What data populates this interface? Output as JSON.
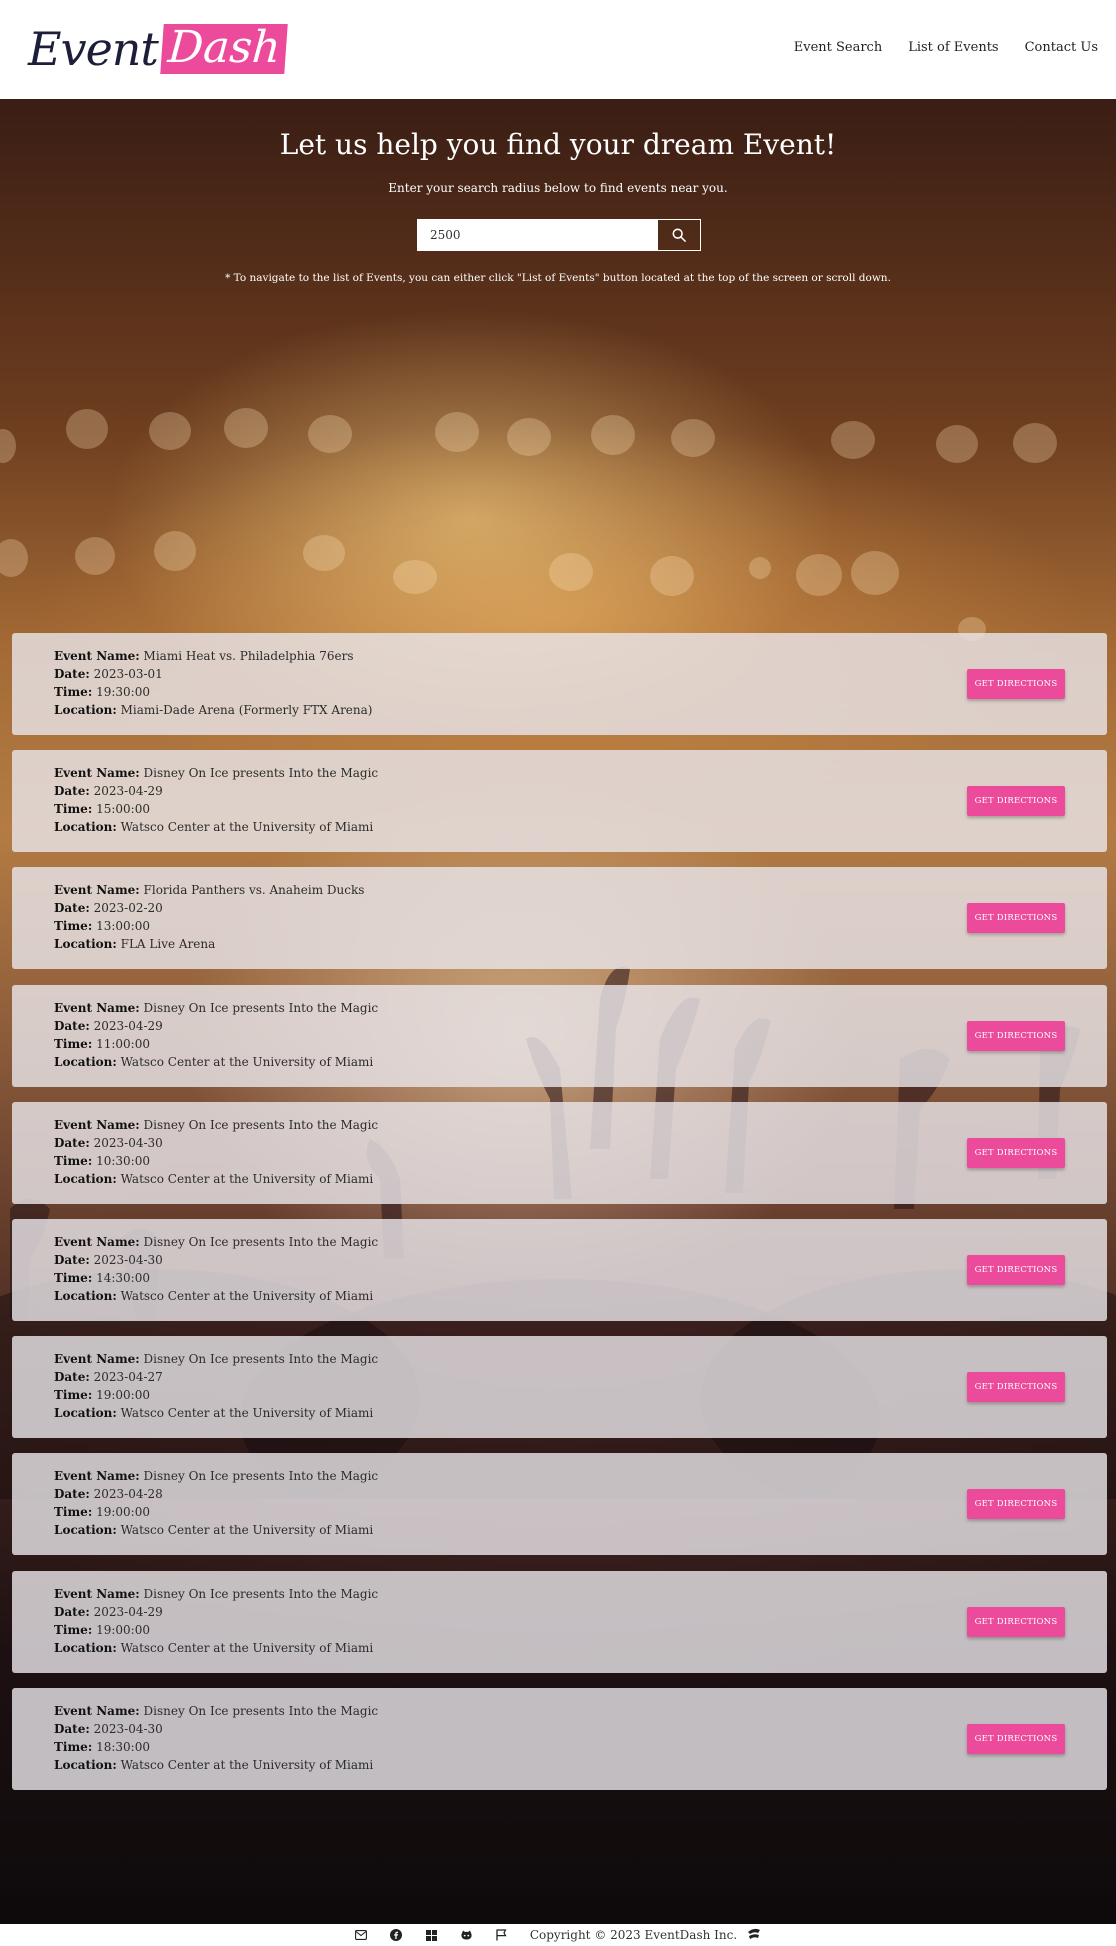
{
  "brand": {
    "logo_part1": "Event",
    "logo_part2": "Dash",
    "accent_color": "#ec4a9b"
  },
  "nav": {
    "items": [
      "Event Search",
      "List of Events",
      "Contact Us"
    ]
  },
  "hero": {
    "title": "Let us help you find your dream Event!",
    "subtitle": "Enter your search radius below to find events near you.",
    "search_value": "2500",
    "search_icon": "search-icon",
    "note": "* To navigate to the list of Events, you can either click \"List of Events\" button located at the top of the screen or scroll down."
  },
  "labels": {
    "name": "Event Name:",
    "date": "Date:",
    "time": "Time:",
    "location": "Location:",
    "button": "GET DIRECTIONS"
  },
  "events": [
    {
      "name": "Miami Heat vs. Philadelphia 76ers",
      "date": "2023-03-01",
      "time": "19:30:00",
      "location": "Miami-Dade Arena (Formerly FTX Arena)"
    },
    {
      "name": "Disney On Ice presents Into the Magic",
      "date": "2023-04-29",
      "time": "15:00:00",
      "location": "Watsco Center at the University of Miami"
    },
    {
      "name": "Florida Panthers vs. Anaheim Ducks",
      "date": "2023-02-20",
      "time": "13:00:00",
      "location": "FLA Live Arena"
    },
    {
      "name": "Disney On Ice presents Into the Magic",
      "date": "2023-04-29",
      "time": "11:00:00",
      "location": "Watsco Center at the University of Miami"
    },
    {
      "name": "Disney On Ice presents Into the Magic",
      "date": "2023-04-30",
      "time": "10:30:00",
      "location": "Watsco Center at the University of Miami"
    },
    {
      "name": "Disney On Ice presents Into the Magic",
      "date": "2023-04-30",
      "time": "14:30:00",
      "location": "Watsco Center at the University of Miami"
    },
    {
      "name": "Disney On Ice presents Into the Magic",
      "date": "2023-04-27",
      "time": "19:00:00",
      "location": "Watsco Center at the University of Miami"
    },
    {
      "name": "Disney On Ice presents Into the Magic",
      "date": "2023-04-28",
      "time": "19:00:00",
      "location": "Watsco Center at the University of Miami"
    },
    {
      "name": "Disney On Ice presents Into the Magic",
      "date": "2023-04-29",
      "time": "19:00:00",
      "location": "Watsco Center at the University of Miami"
    },
    {
      "name": "Disney On Ice presents Into the Magic",
      "date": "2023-04-30",
      "time": "18:30:00",
      "location": "Watsco Center at the University of Miami"
    }
  ],
  "footer": {
    "icons": [
      "mail-icon",
      "facebook-icon",
      "windows-icon",
      "github-icon",
      "flag-icon"
    ],
    "copyright": "Copyright © 2023 EventDash Inc.",
    "logo_icon": "eventdash-mark-icon"
  }
}
